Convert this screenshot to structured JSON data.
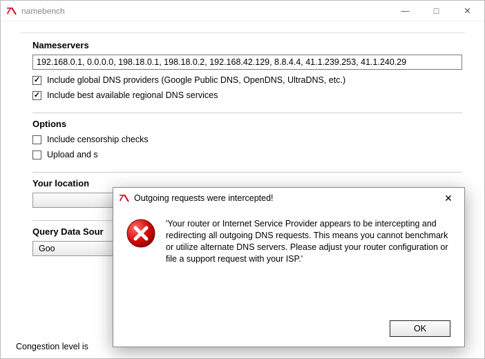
{
  "window": {
    "title": "namebench",
    "minimize": "—",
    "maximize": "□",
    "close": "✕"
  },
  "nameservers": {
    "heading": "Nameservers",
    "value": "192.168.0.1, 0.0.0.0, 198.18.0.1, 198.18.0.2, 192.168.42.129, 8.8.4.4, 41.1.239.253, 41.1.240.29",
    "include_global_label": "Include global DNS providers (Google Public DNS, OpenDNS, UltraDNS, etc.)",
    "include_regional_label": "Include best available regional DNS services",
    "include_global_checked": true,
    "include_regional_checked": true
  },
  "options": {
    "heading": "Options",
    "censorship_label": "Include censorship checks",
    "upload_label": "Upload and s",
    "censorship_checked": false,
    "upload_checked": false
  },
  "location": {
    "heading": "Your location"
  },
  "query": {
    "heading": "Query Data Sour",
    "dropdown_value": "Goo"
  },
  "footer": {
    "congestion_text": "Congestion level is "
  },
  "dialog": {
    "title": "Outgoing requests were intercepted!",
    "message": "'Your router or Internet Service Provider appears to be intercepting and redirecting all outgoing DNS requests. This means you cannot benchmark or utilize alternate DNS servers. Please adjust your router configuration or file a support request with your ISP.'",
    "ok_label": "OK",
    "close": "✕"
  }
}
